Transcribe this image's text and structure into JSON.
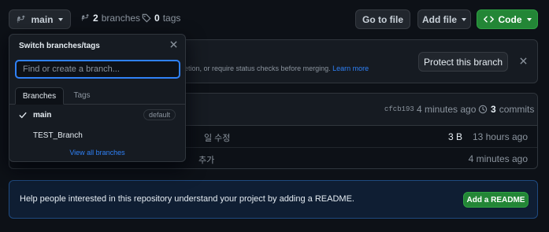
{
  "toolbar": {
    "branch_button": "main",
    "branches_count": "2",
    "branches_label": "branches",
    "tags_count": "0",
    "tags_label": "tags",
    "go_to_file": "Go to file",
    "add_file": "Add file",
    "code": "Code"
  },
  "protect_banner": {
    "text": "etion, or require status checks before merging.",
    "learn_more": "Learn more",
    "button": "Protect this branch"
  },
  "commit_bar": {
    "hash": "cfcb193",
    "time": "4 minutes ago",
    "commits_count": "3",
    "commits_label": "commits"
  },
  "files": [
    {
      "message": "일 수정",
      "size": "3 B",
      "time": "13 hours ago"
    },
    {
      "message": "추가",
      "size": "",
      "time": "4 minutes ago"
    }
  ],
  "readme": {
    "text": "Help people interested in this repository understand your project by adding a README.",
    "button": "Add a README"
  },
  "dropdown": {
    "title": "Switch branches/tags",
    "search_placeholder": "Find or create a branch...",
    "tabs": [
      "Branches",
      "Tags"
    ],
    "items": [
      {
        "label": "main",
        "badge": "default",
        "selected": true
      },
      {
        "label": "TEST_Branch",
        "badge": "",
        "selected": false
      }
    ],
    "view_all": "View all branches"
  },
  "colors": {
    "background": "#0d1117",
    "accent_green": "#238636",
    "link_blue": "#2f81f7",
    "border": "#30363d"
  },
  "icons": [
    "git-branch-icon",
    "tag-icon",
    "code-icon",
    "history-icon",
    "close-icon",
    "check-icon",
    "caret-down-icon"
  ]
}
